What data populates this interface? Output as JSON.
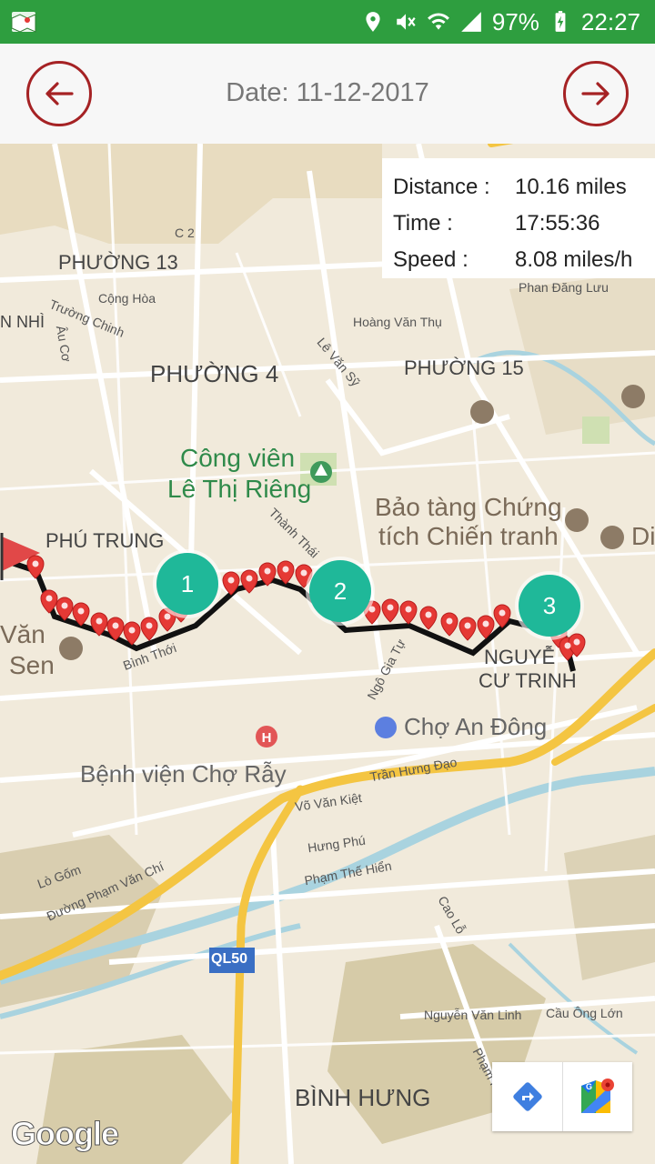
{
  "status_bar": {
    "battery": "97%",
    "time": "22:27",
    "icons": [
      "location-icon",
      "mute-icon",
      "wifi-icon",
      "signal-icon",
      "battery-icon"
    ]
  },
  "header": {
    "date_text": "Date: 11-12-2017",
    "prev_icon": "arrow-left-icon",
    "next_icon": "arrow-right-icon",
    "accent_color": "#a52224"
  },
  "trip_info": {
    "distance_label": "Distance :",
    "distance_value": "10.16 miles",
    "time_label": "Time :",
    "time_value": "17:55:36",
    "speed_label": "Speed :",
    "speed_value": "8.08 miles/h"
  },
  "clusters": [
    {
      "label": "1"
    },
    {
      "label": "2"
    },
    {
      "label": "3"
    }
  ],
  "route_color": "#e53935",
  "cluster_color": "#1fb899",
  "map_labels": {
    "phuong13": "PHƯỜNG 13",
    "phuong4": "PHƯỜNG 4",
    "phuong15": "PHƯỜNG 15",
    "phu_trung": "PHÚ TRUNG",
    "c2": "C 2",
    "cong_hoa": "Cộng Hòa",
    "truong_chinh": "Trường Chinh",
    "hoang_van_thu": "Hoàng Văn Thụ",
    "le_van_sy": "Lê Văn Sỹ",
    "phan_dang_luu": "Phan Đăng Lưu",
    "nhi": "N NHÌ",
    "au_co": "Âu Cơ",
    "park_line1": "Công viên",
    "park_line2": "Lê Thị Riêng",
    "museum_line1": "Bảo tàng Chứng",
    "museum_line2": "tích Chiến tranh",
    "di": "Di",
    "van": "Văn",
    "sen": "Sen",
    "binh_thoi": "Bình Thới",
    "thanh_thai": "Thành Thái",
    "ngo_gia_tu": "Ngô Gia Tự",
    "nguyen_cu_trinh_1": "NGUYỄ",
    "nguyen_cu_trinh_2": "CƯ TRINH",
    "cho_an_dong": "Chợ An Đông",
    "benh_vien": "Bệnh viện Chợ Rẫy",
    "tran_hung_dao": "Trần Hưng Đạo",
    "vo_van_kiet": "Võ Văn Kiệt",
    "hung_phu": "Hưng Phú",
    "pham_the_hien": "Phạm Thế Hiển",
    "lo_gom": "Lò Gốm",
    "pham_van_chi": "Đường Phạm Văn Chí",
    "cao_lo": "Cao Lỗ",
    "ql50": "QL50",
    "nguyen_van_linh": "Nguyễn Văn Linh",
    "cau_ong_lon": "Cầu Ông Lớn",
    "binh_hung": "BÌNH HƯNG",
    "pham_hung": "Phạm Hùng",
    "google": "Google"
  },
  "map_tools": {
    "directions_icon": "directions-icon",
    "google_maps_icon": "google-maps-icon"
  }
}
